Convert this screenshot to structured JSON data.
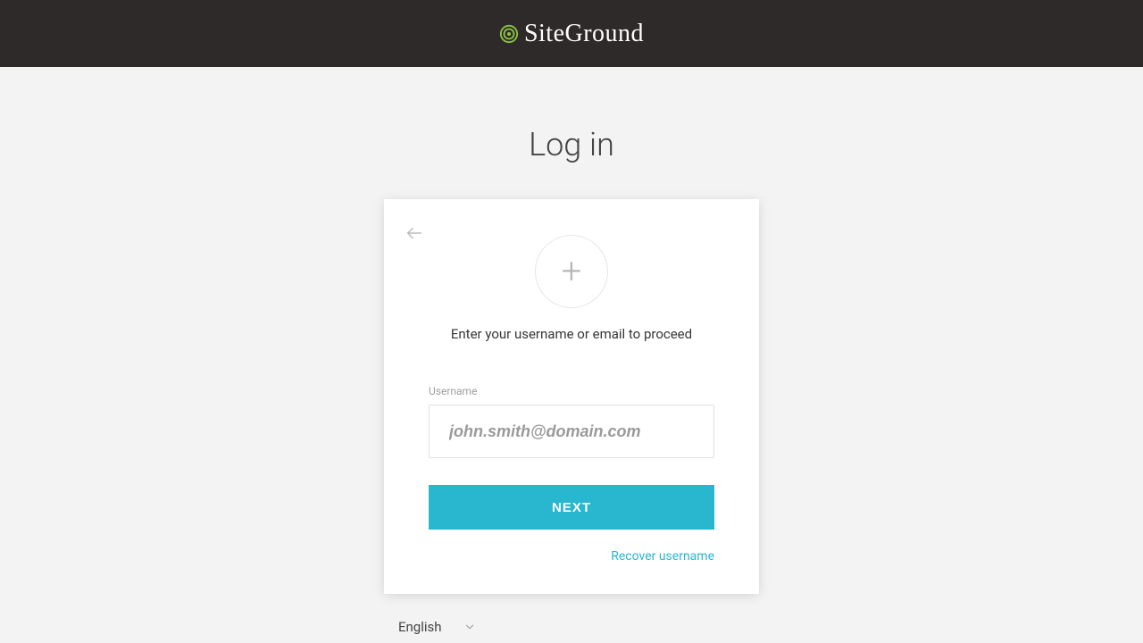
{
  "brand": {
    "name": "SiteGround"
  },
  "login": {
    "title": "Log in",
    "instruction": "Enter your username or email to proceed",
    "username_label": "Username",
    "username_placeholder": "john.smith@domain.com",
    "next_button": "NEXT",
    "recover_link": "Recover username"
  },
  "language": {
    "current": "English"
  },
  "colors": {
    "header_bg": "#2e2a2a",
    "accent": "#29b6cf",
    "logo_accent": "#8cc63f"
  }
}
